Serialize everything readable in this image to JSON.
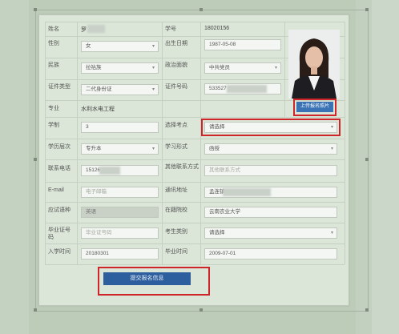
{
  "form": {
    "name": {
      "label": "姓名",
      "value": "罗"
    },
    "student_id": {
      "label": "学号",
      "value": "18020156"
    },
    "gender": {
      "label": "性别",
      "value": "女"
    },
    "birth_date": {
      "label": "出生日期",
      "value": "1987-05-08"
    },
    "ethnicity": {
      "label": "民族",
      "value": "拉祜族"
    },
    "political_status": {
      "label": "政治面貌",
      "value": "中共党员"
    },
    "id_type": {
      "label": "证件类型",
      "value": "二代身份证"
    },
    "id_number": {
      "label": "证件号码",
      "value": "533527"
    },
    "major": {
      "label": "专业",
      "value": "水利水电工程"
    },
    "study_years": {
      "label": "学制",
      "value": "3"
    },
    "exam_site": {
      "label": "选择考点",
      "value": "请选择"
    },
    "education_level": {
      "label": "学历层次",
      "value": "专升本"
    },
    "study_mode": {
      "label": "学习形式",
      "value": "函授"
    },
    "phone": {
      "label": "联系电话",
      "value": "15126"
    },
    "other_contact": {
      "label": "其他联系方式",
      "placeholder": "其他联系方式"
    },
    "email": {
      "label": "E-mail",
      "placeholder": "电子邮箱"
    },
    "address": {
      "label": "通讯地址",
      "value": "孟连镇"
    },
    "exam_language": {
      "label": "应试语种",
      "value": "英语"
    },
    "school": {
      "label": "在籍院校",
      "value": "云南农业大学"
    },
    "graduation_cert": {
      "label": "毕业证号码",
      "placeholder": "毕业证号码"
    },
    "candidate_type": {
      "label": "考生类别",
      "value": "请选择"
    },
    "enrollment_date": {
      "label": "入学时间",
      "value": "20180301"
    },
    "graduation_date": {
      "label": "毕业时间",
      "value": "2009-07-01"
    }
  },
  "buttons": {
    "upload_photo": "上传报名照片",
    "submit": "提交报名信息"
  },
  "icons": {
    "dropdown": "chevron-down-icon"
  },
  "colors": {
    "highlight": "#d0242b",
    "primary_button": "#2d5f9e",
    "upload_button": "#3a73b5"
  }
}
